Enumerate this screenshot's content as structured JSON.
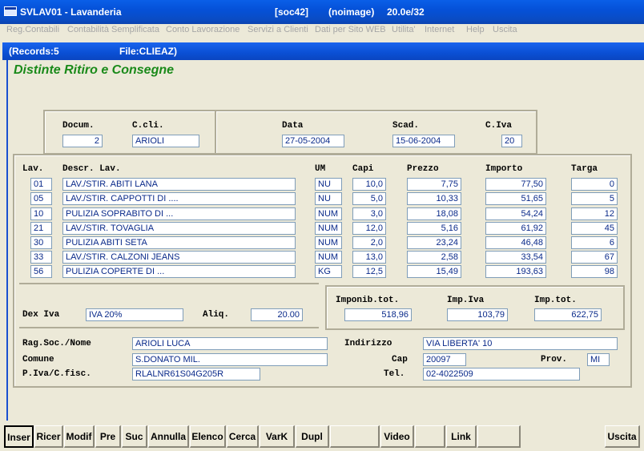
{
  "window": {
    "title": "SVLAV01 - Lavanderia",
    "session": "[soc42]",
    "noimage": "(noimage)",
    "version": "20.0e/32"
  },
  "menu": [
    "Reg.Contabili",
    "Contabilità Semplificata",
    "Conto Lavorazione",
    "Servizi a Clienti",
    "Dati per Sito WEB",
    "Utilita'",
    "Internet",
    "Help",
    "Uscita"
  ],
  "inner": {
    "records": "(Records:5",
    "file": "File:CLIEAZ)"
  },
  "form_title": "Distinte Ritiro e Consegne",
  "header": {
    "docum_label": "Docum.",
    "docum": "2",
    "ccli_label": "C.cli.",
    "ccli": "ARIOLI",
    "data_label": "Data",
    "data": "27-05-2004",
    "scad_label": "Scad.",
    "scad": "15-06-2004",
    "civa_label": "C.Iva",
    "civa": "20"
  },
  "table": {
    "columns": [
      "Lav.",
      "Descr. Lav.",
      "UM",
      "Capi",
      "Prezzo",
      "Importo",
      "Targa"
    ],
    "rows": [
      {
        "lav": "01",
        "descr": "LAV./STIR. ABITI LANA",
        "um": "NU",
        "capi": "10,0",
        "prezzo": "7,75",
        "importo": "77,50",
        "targa": "0"
      },
      {
        "lav": "05",
        "descr": "LAV./STIR. CAPPOTTI DI ....",
        "um": "NU",
        "capi": "5,0",
        "prezzo": "10,33",
        "importo": "51,65",
        "targa": "5"
      },
      {
        "lav": "10",
        "descr": "PULIZIA SOPRABITO DI ...",
        "um": "NUM",
        "capi": "3,0",
        "prezzo": "18,08",
        "importo": "54,24",
        "targa": "12"
      },
      {
        "lav": "21",
        "descr": "LAV./STIR. TOVAGLIA",
        "um": "NUM",
        "capi": "12,0",
        "prezzo": "5,16",
        "importo": "61,92",
        "targa": "45"
      },
      {
        "lav": "30",
        "descr": "PULIZIA ABITI SETA",
        "um": "NUM",
        "capi": "2,0",
        "prezzo": "23,24",
        "importo": "46,48",
        "targa": "6"
      },
      {
        "lav": "33",
        "descr": "LAV./STIR. CALZONI JEANS",
        "um": "NUM",
        "capi": "13,0",
        "prezzo": "2,58",
        "importo": "33,54",
        "targa": "67"
      },
      {
        "lav": "56",
        "descr": "PULIZIA COPERTE DI  ...",
        "um": "KG",
        "capi": "12,5",
        "prezzo": "15,49",
        "importo": "193,63",
        "targa": "98"
      }
    ]
  },
  "iva": {
    "dex_label": "Dex Iva",
    "dex": "IVA 20%",
    "aliq_label": "Aliq.",
    "aliq": "20.00"
  },
  "totals": {
    "imponib_label": "Imponib.tot.",
    "imponib": "518,96",
    "impiva_label": "Imp.Iva",
    "impiva": "103,79",
    "imptot_label": "Imp.tot.",
    "imptot": "622,75"
  },
  "client": {
    "ragsoc_label": "Rag.Soc./Nome",
    "ragsoc": "ARIOLI LUCA",
    "indirizzo_label": "Indirizzo",
    "indirizzo": "VIA LIBERTA' 10",
    "comune_label": "Comune",
    "comune": "S.DONATO MIL.",
    "cap_label": "Cap",
    "cap": "20097",
    "prov_label": "Prov.",
    "prov": "MI",
    "piva_label": "P.Iva/C.fisc.",
    "piva": "RLALNR61S04G205R",
    "tel_label": "Tel.",
    "tel": "02-4022509"
  },
  "buttons": [
    "Inser",
    "Ricer",
    "Modif",
    "Pre",
    "Suc",
    "Annulla",
    "Elenco",
    "Cerca",
    "VarK",
    "Dupl",
    "",
    "Video",
    "",
    "Link",
    "",
    "Uscita"
  ]
}
